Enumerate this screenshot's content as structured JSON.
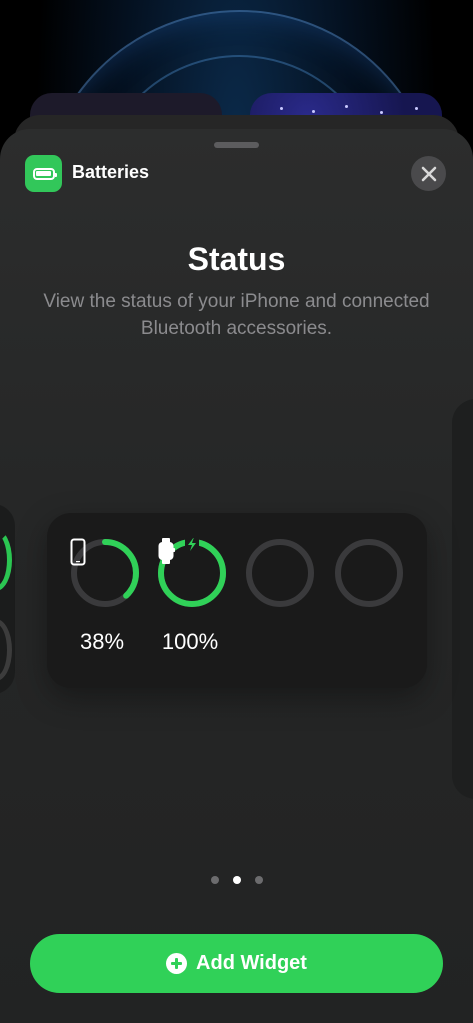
{
  "header": {
    "app_name": "Batteries",
    "app_icon": "battery-icon",
    "close_icon": "close-icon"
  },
  "main": {
    "title": "Status",
    "subtitle": "View the status of your iPhone and connected Bluetooth accessories."
  },
  "widget": {
    "devices": [
      {
        "name": "iPhone",
        "icon": "iphone-icon",
        "level": 0.38,
        "label": "38%",
        "charging": false
      },
      {
        "name": "Apple Watch",
        "icon": "watch-icon",
        "level": 1.0,
        "label": "100%",
        "charging": true
      },
      {
        "name": "empty-slot-1",
        "level": null,
        "label": ""
      },
      {
        "name": "empty-slot-2",
        "level": null,
        "label": ""
      }
    ],
    "colors": {
      "ring_fill": "#30d158",
      "ring_track": "#3a3a3c"
    }
  },
  "pager": {
    "total": 3,
    "current": 2
  },
  "footer": {
    "add_button_label": "Add Widget",
    "add_icon": "plus-circle-icon",
    "accent": "#30d158"
  }
}
